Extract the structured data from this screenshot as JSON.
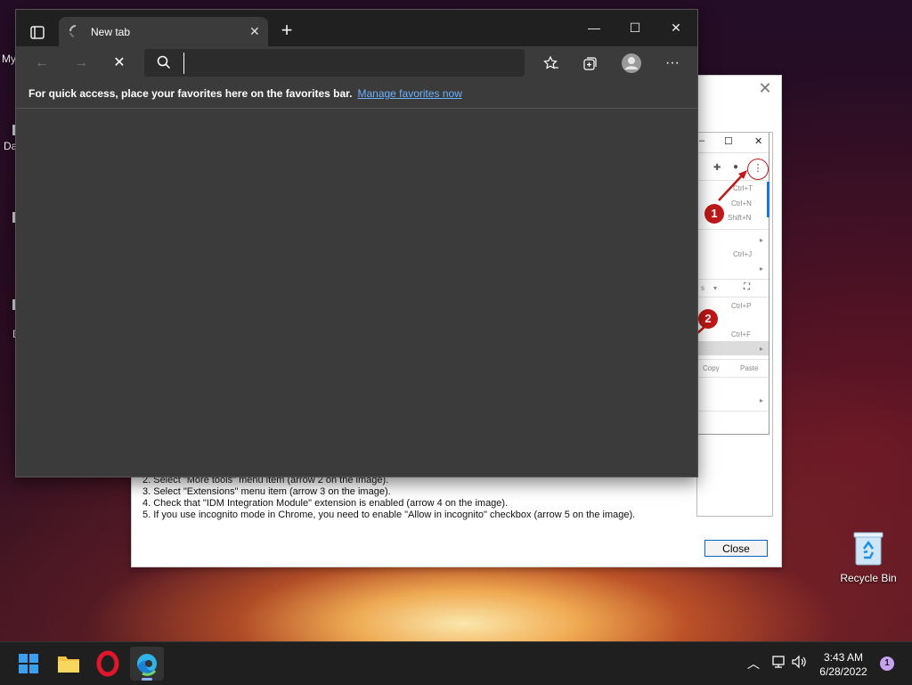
{
  "browser": {
    "tab_title": "New tab",
    "tab_close": "✕",
    "new_tab": "+",
    "window_controls": {
      "minimize": "—",
      "maximize": "☐",
      "close": "✕"
    },
    "address_placeholder": "",
    "favorites_message": "For quick access, place your favorites here on the favorites bar.",
    "favorites_link": "Manage favorites now",
    "icons": [
      "back-icon",
      "forward-icon",
      "stop-icon",
      "search-icon",
      "favorites-icon",
      "collections-icon",
      "profile-icon",
      "more-icon"
    ]
  },
  "idm_dialog": {
    "close_label": "Close",
    "instructions": [
      "2. Select \"More tools\" menu item (arrow 2 on the image).",
      "3. Select \"Extensions\" menu item (arrow 3 on the image).",
      "4. Check that \"IDM Integration Module\" extension is enabled (arrow 4 on the image).",
      "5. If you use incognito mode in Chrome, you need to enable \"Allow in incognito\" checkbox (arrow 5 on the image)."
    ],
    "demo": {
      "badges": [
        "1",
        "2"
      ],
      "menu_texts": [
        "Ctrl+T",
        "Ctrl+N",
        "Shift+N",
        "Ctrl+J",
        "Ctrl+P",
        "Ctrl+F",
        "Copy",
        "Paste"
      ]
    }
  },
  "desktop": {
    "fragments": [
      "My",
      "Da",
      "D"
    ],
    "recycle_bin_label": "Recycle Bin"
  },
  "taskbar": {
    "time": "3:43 AM",
    "date": "6/28/2022",
    "notification_count": "1",
    "apps": [
      "windows-start",
      "file-explorer",
      "opera",
      "edge"
    ]
  },
  "colors": {
    "accent_link": "#6cb2ff",
    "badge_red": "#c01818",
    "window_dark": "#202020"
  }
}
